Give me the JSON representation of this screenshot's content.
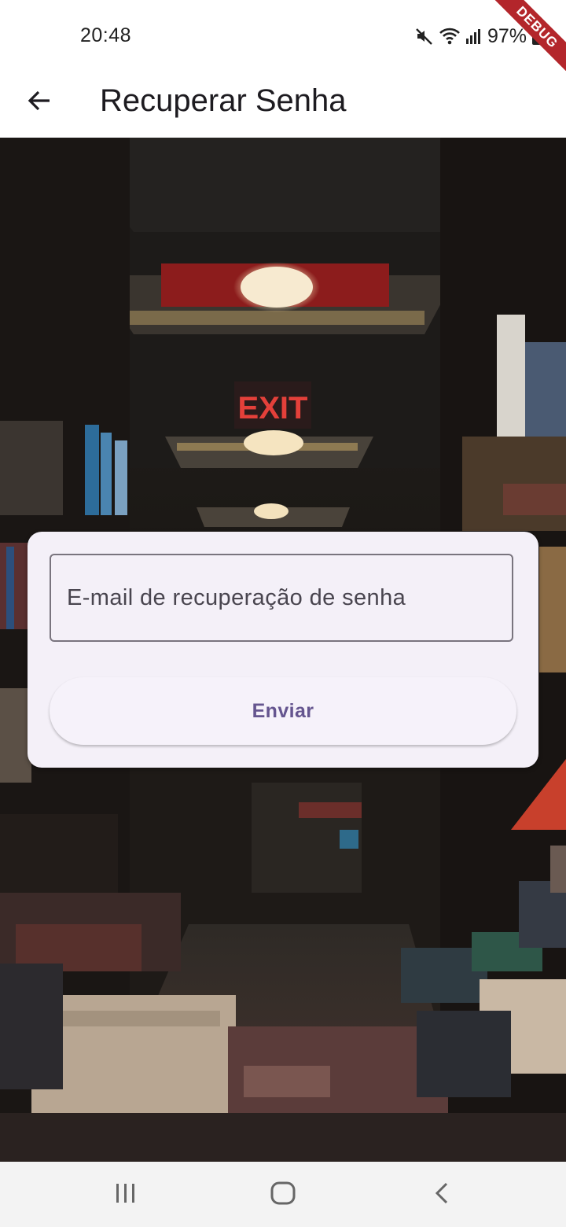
{
  "status_bar": {
    "time": "20:48",
    "battery_percent": "97%",
    "debug_label": "DEBUG",
    "icons": [
      "mute-icon",
      "wifi-icon",
      "signal-icon",
      "battery-icon"
    ]
  },
  "app_bar": {
    "title": "Recuperar Senha",
    "back_icon": "arrow-back-icon"
  },
  "form": {
    "email_placeholder": "E-mail de recuperação de senha",
    "email_value": "",
    "send_label": "Enviar"
  },
  "nav_bar": {
    "items": [
      "recent-apps-icon",
      "home-icon",
      "back-icon"
    ]
  },
  "colors": {
    "card_background": "#f4f0f8",
    "button_text": "#65558f",
    "field_border": "#79747e",
    "debug_ribbon": "#b3262b"
  }
}
